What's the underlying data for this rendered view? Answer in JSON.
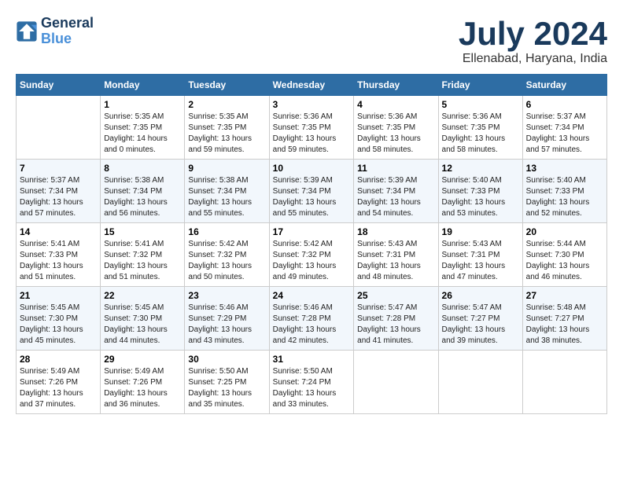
{
  "header": {
    "logo_line1": "General",
    "logo_line2": "Blue",
    "month_title": "July 2024",
    "location": "Ellenabad, Haryana, India"
  },
  "weekdays": [
    "Sunday",
    "Monday",
    "Tuesday",
    "Wednesday",
    "Thursday",
    "Friday",
    "Saturday"
  ],
  "weeks": [
    [
      {
        "day": "",
        "info": ""
      },
      {
        "day": "1",
        "info": "Sunrise: 5:35 AM\nSunset: 7:35 PM\nDaylight: 14 hours\nand 0 minutes."
      },
      {
        "day": "2",
        "info": "Sunrise: 5:35 AM\nSunset: 7:35 PM\nDaylight: 13 hours\nand 59 minutes."
      },
      {
        "day": "3",
        "info": "Sunrise: 5:36 AM\nSunset: 7:35 PM\nDaylight: 13 hours\nand 59 minutes."
      },
      {
        "day": "4",
        "info": "Sunrise: 5:36 AM\nSunset: 7:35 PM\nDaylight: 13 hours\nand 58 minutes."
      },
      {
        "day": "5",
        "info": "Sunrise: 5:36 AM\nSunset: 7:35 PM\nDaylight: 13 hours\nand 58 minutes."
      },
      {
        "day": "6",
        "info": "Sunrise: 5:37 AM\nSunset: 7:34 PM\nDaylight: 13 hours\nand 57 minutes."
      }
    ],
    [
      {
        "day": "7",
        "info": "Sunrise: 5:37 AM\nSunset: 7:34 PM\nDaylight: 13 hours\nand 57 minutes."
      },
      {
        "day": "8",
        "info": "Sunrise: 5:38 AM\nSunset: 7:34 PM\nDaylight: 13 hours\nand 56 minutes."
      },
      {
        "day": "9",
        "info": "Sunrise: 5:38 AM\nSunset: 7:34 PM\nDaylight: 13 hours\nand 55 minutes."
      },
      {
        "day": "10",
        "info": "Sunrise: 5:39 AM\nSunset: 7:34 PM\nDaylight: 13 hours\nand 55 minutes."
      },
      {
        "day": "11",
        "info": "Sunrise: 5:39 AM\nSunset: 7:34 PM\nDaylight: 13 hours\nand 54 minutes."
      },
      {
        "day": "12",
        "info": "Sunrise: 5:40 AM\nSunset: 7:33 PM\nDaylight: 13 hours\nand 53 minutes."
      },
      {
        "day": "13",
        "info": "Sunrise: 5:40 AM\nSunset: 7:33 PM\nDaylight: 13 hours\nand 52 minutes."
      }
    ],
    [
      {
        "day": "14",
        "info": "Sunrise: 5:41 AM\nSunset: 7:33 PM\nDaylight: 13 hours\nand 51 minutes."
      },
      {
        "day": "15",
        "info": "Sunrise: 5:41 AM\nSunset: 7:32 PM\nDaylight: 13 hours\nand 51 minutes."
      },
      {
        "day": "16",
        "info": "Sunrise: 5:42 AM\nSunset: 7:32 PM\nDaylight: 13 hours\nand 50 minutes."
      },
      {
        "day": "17",
        "info": "Sunrise: 5:42 AM\nSunset: 7:32 PM\nDaylight: 13 hours\nand 49 minutes."
      },
      {
        "day": "18",
        "info": "Sunrise: 5:43 AM\nSunset: 7:31 PM\nDaylight: 13 hours\nand 48 minutes."
      },
      {
        "day": "19",
        "info": "Sunrise: 5:43 AM\nSunset: 7:31 PM\nDaylight: 13 hours\nand 47 minutes."
      },
      {
        "day": "20",
        "info": "Sunrise: 5:44 AM\nSunset: 7:30 PM\nDaylight: 13 hours\nand 46 minutes."
      }
    ],
    [
      {
        "day": "21",
        "info": "Sunrise: 5:45 AM\nSunset: 7:30 PM\nDaylight: 13 hours\nand 45 minutes."
      },
      {
        "day": "22",
        "info": "Sunrise: 5:45 AM\nSunset: 7:30 PM\nDaylight: 13 hours\nand 44 minutes."
      },
      {
        "day": "23",
        "info": "Sunrise: 5:46 AM\nSunset: 7:29 PM\nDaylight: 13 hours\nand 43 minutes."
      },
      {
        "day": "24",
        "info": "Sunrise: 5:46 AM\nSunset: 7:28 PM\nDaylight: 13 hours\nand 42 minutes."
      },
      {
        "day": "25",
        "info": "Sunrise: 5:47 AM\nSunset: 7:28 PM\nDaylight: 13 hours\nand 41 minutes."
      },
      {
        "day": "26",
        "info": "Sunrise: 5:47 AM\nSunset: 7:27 PM\nDaylight: 13 hours\nand 39 minutes."
      },
      {
        "day": "27",
        "info": "Sunrise: 5:48 AM\nSunset: 7:27 PM\nDaylight: 13 hours\nand 38 minutes."
      }
    ],
    [
      {
        "day": "28",
        "info": "Sunrise: 5:49 AM\nSunset: 7:26 PM\nDaylight: 13 hours\nand 37 minutes."
      },
      {
        "day": "29",
        "info": "Sunrise: 5:49 AM\nSunset: 7:26 PM\nDaylight: 13 hours\nand 36 minutes."
      },
      {
        "day": "30",
        "info": "Sunrise: 5:50 AM\nSunset: 7:25 PM\nDaylight: 13 hours\nand 35 minutes."
      },
      {
        "day": "31",
        "info": "Sunrise: 5:50 AM\nSunset: 7:24 PM\nDaylight: 13 hours\nand 33 minutes."
      },
      {
        "day": "",
        "info": ""
      },
      {
        "day": "",
        "info": ""
      },
      {
        "day": "",
        "info": ""
      }
    ]
  ]
}
